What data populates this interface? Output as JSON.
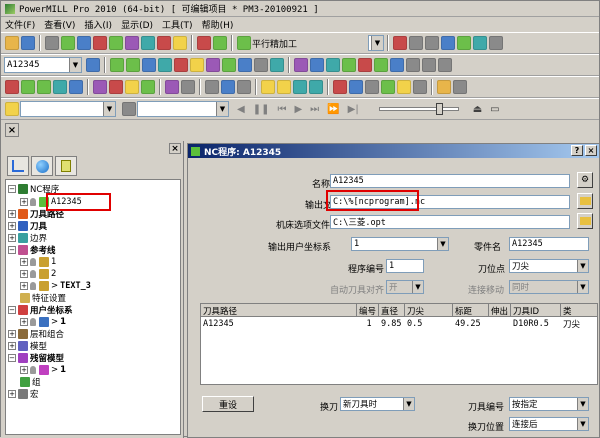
{
  "app": {
    "title": "PowerMILL Pro 2010 (64-bit)  [ 可编辑项目 * PM3-20100921 ]"
  },
  "menu": [
    "文件(F)",
    "查看(V)",
    "插入(I)",
    "显示(D)",
    "工具(T)",
    "帮助(H)"
  ],
  "toolbar1": {
    "strategy_label": "平行精加工"
  },
  "toolbar2": {
    "combo_value": "A12345"
  },
  "tree": {
    "items": [
      {
        "label": "NC程序",
        "bold": false
      },
      {
        "label": "A12345",
        "bold": false
      },
      {
        "label": "刀具路径",
        "bold": true
      },
      {
        "label": "刀具",
        "bold": true
      },
      {
        "label": "边界",
        "bold": false
      },
      {
        "label": "参考线",
        "bold": true
      },
      {
        "label": "1",
        "bold": false
      },
      {
        "label": "2",
        "bold": false
      },
      {
        "label": "TEXT_3",
        "bold": true
      },
      {
        "label": "特征设置",
        "bold": false
      },
      {
        "label": "用户坐标系",
        "bold": true
      },
      {
        "label": "1",
        "bold": true
      },
      {
        "label": "层和组合",
        "bold": false
      },
      {
        "label": "模型",
        "bold": false
      },
      {
        "label": "残留模型",
        "bold": true
      },
      {
        "label": "1",
        "bold": true
      },
      {
        "label": "组",
        "bold": false
      },
      {
        "label": "宏",
        "bold": false
      }
    ]
  },
  "dialog": {
    "title": "NC程序:     A12345",
    "name_label": "名称",
    "name_value": "A12345",
    "output_label": "输出文件",
    "output_value": "C:\\%[ncprogram].nc",
    "option_label": "机床选项文件",
    "option_value": "C:\\三菱.opt",
    "ucs_label": "输出用户坐标系",
    "ucs_value": "1",
    "part_label": "零件名",
    "part_value": "A12345",
    "prognum_label": "程序编号",
    "prognum_value": "1",
    "tooltip_label": "刀位点",
    "tooltip_value": "刀尖",
    "auto_align_label": "自动刀具对齐",
    "auto_align_value": "开",
    "link_label": "连接移动",
    "link_value": "同时",
    "table": {
      "headers": [
        "刀具路径",
        "编号",
        "直径",
        "刀尖",
        "标距",
        "伸出",
        "刀具ID",
        "类"
      ],
      "rows": [
        [
          "A12345",
          "1",
          "9.85",
          "0.5",
          "49.25",
          "",
          "D10R0.5",
          "刀尖"
        ]
      ]
    },
    "reset_label": "重设",
    "toolchange_label": "换刀",
    "toolchange_value": "新刀具时",
    "toolnum_label": "刀具编号",
    "toolnum_value": "按指定",
    "toolchange_pos_label": "换刀位置",
    "toolchange_pos_value": "连接后"
  }
}
